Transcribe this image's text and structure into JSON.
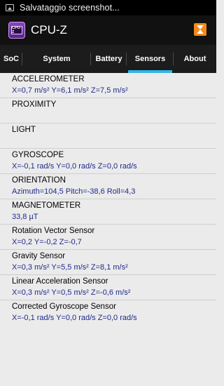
{
  "status_bar": {
    "text": "Salvataggio screenshot..."
  },
  "app": {
    "title": "CPU-Z",
    "icon_text": "CPU-Z"
  },
  "tabs": [
    {
      "label": "SoC"
    },
    {
      "label": "System"
    },
    {
      "label": "Battery"
    },
    {
      "label": "Sensors",
      "active": true
    },
    {
      "label": "About"
    }
  ],
  "sensors": [
    {
      "name": "ACCELEROMETER",
      "value": "X=0,7 m/s²  Y=6,1 m/s²  Z=7,5 m/s²"
    },
    {
      "name": "PROXIMITY",
      "value": ""
    },
    {
      "name": "LIGHT",
      "value": ""
    },
    {
      "name": "GYROSCOPE",
      "value": "X=-0,1 rad/s  Y=0,0 rad/s  Z=0,0 rad/s"
    },
    {
      "name": "ORIENTATION",
      "value": "Azimuth=104,5  Pitch=-38,6  Roll=4,3"
    },
    {
      "name": "MAGNETOMETER",
      "value": "33,8 µT"
    },
    {
      "name": "Rotation Vector Sensor",
      "value": "X=0,2  Y=-0,2  Z=-0,7"
    },
    {
      "name": "Gravity Sensor",
      "value": "X=0,3 m/s²  Y=5,5 m/s²  Z=8,1 m/s²"
    },
    {
      "name": "Linear Acceleration Sensor",
      "value": "X=0,3 m/s²  Y=0,5 m/s²  Z=-0,6 m/s²"
    },
    {
      "name": "Corrected Gyroscope Sensor",
      "value": "X=-0,1 rad/s  Y=0,0 rad/s  Z=0,0 rad/s"
    }
  ],
  "colors": {
    "accent": "#33b5e5",
    "value_text": "#1f2a8a",
    "background": "#ebebeb",
    "action_icon": "#f28a1a"
  }
}
